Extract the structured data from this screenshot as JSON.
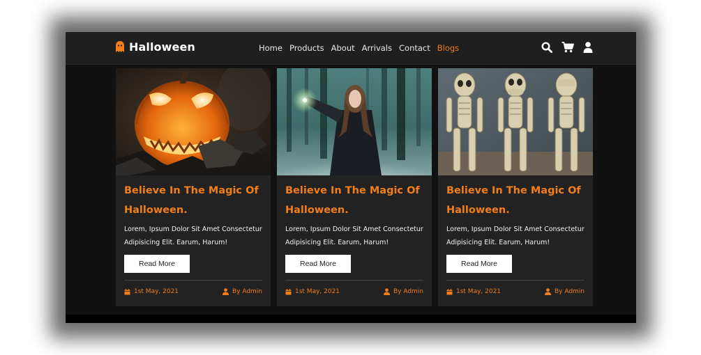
{
  "brand": {
    "name": "Halloween",
    "icon": "ghost-icon"
  },
  "nav": {
    "links": [
      "Home",
      "Products",
      "About",
      "Arrivals",
      "Contact",
      "Blogs"
    ],
    "active": "Blogs",
    "icons": [
      "search-icon",
      "cart-icon",
      "user-icon"
    ]
  },
  "colors": {
    "accent": "#f07e1b",
    "navbar": "#1f1f1f",
    "card": "#222222",
    "page": "#111111"
  },
  "cards": [
    {
      "image": "pumpkin-photo",
      "title": "Believe In The Magic Of Halloween.",
      "text": "Lorem, Ipsum Dolor Sit Amet Consectetur Adipisicing Elit. Earum, Harum!",
      "button": "Read More",
      "date": "1st May, 2021",
      "author": "By Admin"
    },
    {
      "image": "witch-in-forest-photo",
      "title": "Believe In The Magic Of Halloween.",
      "text": "Lorem, Ipsum Dolor Sit Amet Consectetur Adipisicing Elit. Earum, Harum!",
      "button": "Read More",
      "date": "1st May, 2021",
      "author": "By Admin"
    },
    {
      "image": "three-skeletons-photo",
      "title": "Believe In The Magic Of Halloween.",
      "text": "Lorem, Ipsum Dolor Sit Amet Consectetur Adipisicing Elit. Earum, Harum!",
      "button": "Read More",
      "date": "1st May, 2021",
      "author": "By Admin"
    }
  ]
}
